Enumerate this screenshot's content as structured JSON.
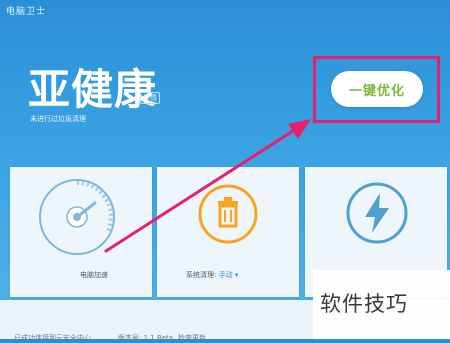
{
  "window": {
    "title": "电脑卫士"
  },
  "status": {
    "heading": "亚健康",
    "detail_tag": "详情",
    "subtitle": "未进行过垃圾清理"
  },
  "actions": {
    "optimize_label": "一键优化"
  },
  "cards": [
    {
      "name": "speedup",
      "label": "电脑加速",
      "icon": "speedometer-icon"
    },
    {
      "name": "cleanup",
      "label": "系统清理:",
      "mode": "手动 ▾",
      "icon": "trash-icon"
    },
    {
      "name": "boost",
      "label": "",
      "icon": "lightning-icon"
    }
  ],
  "footer": {
    "left": "已成功连接到云安全中心",
    "version": "版本号: 1.1 Beta",
    "update": "检查更新"
  },
  "watermark": {
    "text": "软件技巧"
  },
  "colors": {
    "background": "#3aa3e3",
    "button_text": "#7cb83a",
    "highlight": "#e61f6e",
    "trash_orange": "#f5a623",
    "icon_blue": "#4f9fd3"
  }
}
